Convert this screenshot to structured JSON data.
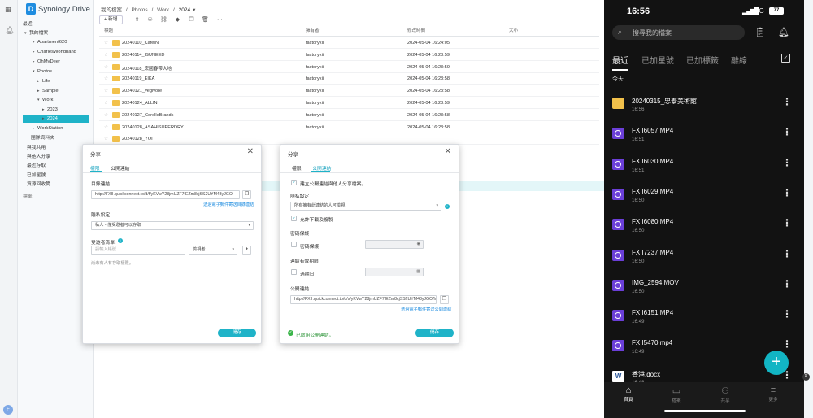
{
  "app": {
    "name": "Synology Drive",
    "logo_letter": "D"
  },
  "sidebar": {
    "recent": "最近",
    "mine": "我的檔案",
    "apartment": "Apartment620",
    "charles": "CharlesWondrland",
    "ohmy": "OhMyDeer",
    "photos": "Photos",
    "life": "Life",
    "sample": "Sample",
    "work": "Work",
    "y2023": "2023",
    "y2024": "2024",
    "workstation": "WorkStation",
    "team": "團隊資料夾",
    "shared": "與我共用",
    "shared_others": "與他人分享",
    "recent2": "最近存取",
    "starred": "已加星號",
    "trash": "資源回收筒",
    "tags": "標籤"
  },
  "breadcrumb": {
    "mine": "我的檔案",
    "sep": "/",
    "photos": "Photos",
    "work": "Work",
    "current": "2024"
  },
  "toolbar": {
    "new": "新增"
  },
  "table": {
    "headers": {
      "name": "標題",
      "owner": "擁有者",
      "modified": "修改時間",
      "size": "大小"
    },
    "rows": [
      {
        "name": "20240110_CafeIN",
        "owner": "factoryxii",
        "date": "2024-05-04 16:24:05"
      },
      {
        "name": "20240114_ISUNEED",
        "owner": "factoryxii",
        "date": "2024-05-04 16:23:59"
      },
      {
        "name": "20240118_宏國春帶大地",
        "owner": "factoryxii",
        "date": "2024-05-04 16:23:59"
      },
      {
        "name": "20240119_EIKA",
        "owner": "factoryxii",
        "date": "2024-05-04 16:23:58"
      },
      {
        "name": "20240121_vegivore",
        "owner": "factoryxii",
        "date": "2024-05-04 16:23:58"
      },
      {
        "name": "20240124_ALLIN",
        "owner": "factoryxii",
        "date": "2024-05-04 16:23:59"
      },
      {
        "name": "20240127_CorelleBrands",
        "owner": "factoryxii",
        "date": "2024-05-04 16:23:58"
      },
      {
        "name": "20240128_ASAHISUPERDRY",
        "owner": "factoryxii",
        "date": "2024-05-04 16:23:58"
      },
      {
        "name": "20240128_YOI",
        "owner": "",
        "date": ""
      }
    ]
  },
  "dialog1": {
    "title": "分享",
    "tab_perm": "權限",
    "tab_link": "公開連結",
    "link_label": "目錄連結",
    "link_value": "http://FXII.quickconnect.to/d/f/yKVwY28jmUZF7fEZm8cjSS2UYM43yJGO",
    "email_link": "透過電子郵件寄送目錄連結",
    "privacy_label": "隱私設定",
    "privacy_value": "私人 - 僅受邀者可以存取",
    "invitee_label": "受邀者清單:",
    "invitee_placeholder": "請輸入帳號",
    "role": "檢視者",
    "no_perm": "尚未有人有存取權限。",
    "save": "儲存"
  },
  "dialog2": {
    "title": "分享",
    "tab_perm": "權限",
    "tab_link": "公開連結",
    "create_public": "建立公開連結與他人分享檔案。",
    "privacy_label": "隱私設定",
    "privacy_value": "所有擁有此連結的人可檢視",
    "allow_download": "允許下載及複製",
    "password_label": "密碼保護",
    "password_check": "密碼保護",
    "expiry_label": "連結有效期限",
    "expiry_check": "過期日",
    "public_link_label": "公開連結",
    "public_link_value": "http://FXII.quickconnect.to/d/s/yKVwY28jmUZF7fEZm8cjSS2UYM43yJGO/h",
    "email_link": "透過電子郵件寄送公開連結",
    "enabled": "已啟用公開連結。",
    "save": "儲存"
  },
  "phone": {
    "status": {
      "time": "16:56",
      "network": "4G",
      "battery": "77"
    },
    "search_placeholder": "搜尋我的檔案",
    "tabs": [
      "最近",
      "已加星號",
      "已加標籤",
      "離線"
    ],
    "section": "今天",
    "files": [
      {
        "name": "20240315_忠泰美術館",
        "time": "16:56",
        "icon": "folder-icon"
      },
      {
        "name": "FXII6057.MP4",
        "time": "16:51",
        "icon": "video-icon"
      },
      {
        "name": "FXII6030.MP4",
        "time": "16:51",
        "icon": "video-icon"
      },
      {
        "name": "FXII6029.MP4",
        "time": "16:50",
        "icon": "video-icon"
      },
      {
        "name": "FXII6080.MP4",
        "time": "16:50",
        "icon": "video-icon"
      },
      {
        "name": "FXII7237.MP4",
        "time": "16:50",
        "icon": "video-icon"
      },
      {
        "name": "IMG_2594.MOV",
        "time": "16:50",
        "icon": "video-icon"
      },
      {
        "name": "FXII6151.MP4",
        "time": "16:49",
        "icon": "video-icon"
      },
      {
        "name": "FXII5470.mp4",
        "time": "16:49",
        "icon": "video-icon"
      },
      {
        "name": "香港.docx",
        "time": "16:48",
        "icon": "word-doc-icon"
      }
    ],
    "nav": [
      "首頁",
      "檔案",
      "共享",
      "更多"
    ]
  },
  "colors": {
    "accent": "#1fb3c8",
    "folder": "#f2c14b",
    "video": "#6b3fd8",
    "fab": "#12b5c4"
  }
}
